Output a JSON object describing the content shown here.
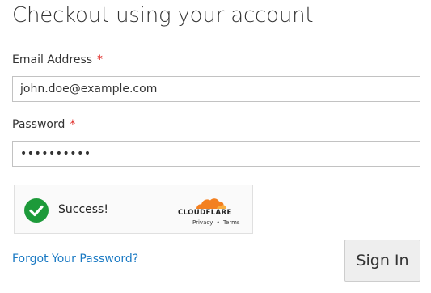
{
  "page": {
    "title": "Checkout using your account"
  },
  "form": {
    "email": {
      "label": "Email Address",
      "required_mark": "*",
      "value": "john.doe@example.com"
    },
    "password": {
      "label": "Password",
      "required_mark": "*",
      "value": "••••••••••"
    }
  },
  "captcha": {
    "status_text": "Success!",
    "brand_text": "CLOUDFLARE",
    "privacy_link": "Privacy",
    "separator": "•",
    "terms_link": "Terms",
    "check_color": "#1d9a3a",
    "brand_color": "#f38020"
  },
  "actions": {
    "forgot_password": "Forgot Your Password?",
    "sign_in": "Sign In"
  }
}
